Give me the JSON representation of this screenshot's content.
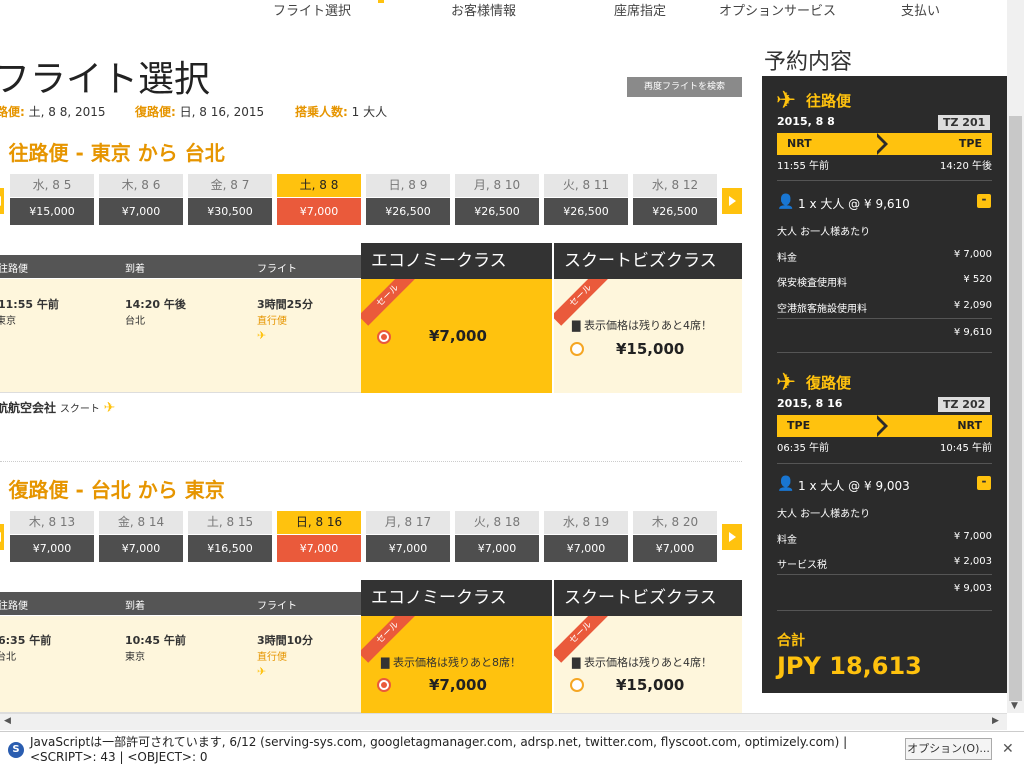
{
  "steps": [
    "フライト選択",
    "お客様情報",
    "座席指定",
    "オプションサービス",
    "支払い"
  ],
  "page_title": "フライト選択",
  "summary": {
    "out_label": "路便:",
    "out_value": "土, 8 8, 2015",
    "ret_label": "復路便:",
    "ret_value": "日, 8 16, 2015",
    "pax_label": "搭乗人数:",
    "pax_value": "1 大人"
  },
  "research_button": "再度フライトを検索",
  "outbound": {
    "heading": "往路便 - 東京 から 台北",
    "dates": [
      {
        "day": "水, 8 5",
        "price": "¥15,000"
      },
      {
        "day": "木, 8 6",
        "price": "¥7,000"
      },
      {
        "day": "金, 8 7",
        "price": "¥30,500"
      },
      {
        "day": "土, 8 8",
        "price": "¥7,000",
        "selected": true
      },
      {
        "day": "日, 8 9",
        "price": "¥26,500"
      },
      {
        "day": "月, 8 10",
        "price": "¥26,500"
      },
      {
        "day": "火, 8 11",
        "price": "¥26,500"
      },
      {
        "day": "水, 8 12",
        "price": "¥26,500"
      }
    ],
    "col_dep": "往路便",
    "col_arr": "到着",
    "col_flight": "フライト",
    "economy": "エコノミークラス",
    "business": "スクートビズクラス",
    "dep_time": "11:55 午前",
    "dep_city": "東京",
    "arr_time": "14:20 午後",
    "arr_city": "台北",
    "duration": "3時間25分",
    "stops": "直行便",
    "sale": "セール",
    "econ_price": "¥7,000",
    "biz_remaining": "表示価格は残りあと4席！",
    "biz_price": "¥15,000",
    "airline_label": "航航空会社",
    "airline_name": "スクート"
  },
  "inbound": {
    "heading": "復路便 - 台北 から 東京",
    "dates": [
      {
        "day": "木, 8 13",
        "price": "¥7,000"
      },
      {
        "day": "金, 8 14",
        "price": "¥7,000"
      },
      {
        "day": "土, 8 15",
        "price": "¥16,500"
      },
      {
        "day": "日, 8 16",
        "price": "¥7,000",
        "selected": true
      },
      {
        "day": "月, 8 17",
        "price": "¥7,000"
      },
      {
        "day": "火, 8 18",
        "price": "¥7,000"
      },
      {
        "day": "水, 8 19",
        "price": "¥7,000"
      },
      {
        "day": "木, 8 20",
        "price": "¥7,000"
      }
    ],
    "col_dep": "往路便",
    "col_arr": "到着",
    "col_flight": "フライト",
    "economy": "エコノミークラス",
    "business": "スクートビズクラス",
    "dep_time": "6:35 午前",
    "dep_city": "台北",
    "arr_time": "10:45 午前",
    "arr_city": "東京",
    "duration": "3時間10分",
    "stops": "直行便",
    "sale": "セール",
    "econ_remaining": "表示価格は残りあと8席！",
    "econ_price": "¥7,000",
    "biz_remaining": "表示価格は残りあと4席！",
    "biz_price": "¥15,000"
  },
  "sidebar": {
    "title": "予約内容",
    "out": {
      "label": "往路便",
      "date": "2015, 8 8",
      "flight": "TZ 201",
      "from": "NRT",
      "to": "TPE",
      "dep": "11:55 午前",
      "arr": "14:20 午後",
      "pax": "1 x 大人 @ ¥ 9,610",
      "per": "大人 お一人様あたり",
      "fare_label": "料金",
      "fare": "¥ 7,000",
      "fee1_label": "保安検査使用料",
      "fee1": "¥ 520",
      "fee2_label": "空港旅客施設使用料",
      "fee2": "¥ 2,090",
      "subtotal": "¥ 9,610"
    },
    "ret": {
      "label": "復路便",
      "date": "2015, 8 16",
      "flight": "TZ 202",
      "from": "TPE",
      "to": "NRT",
      "dep": "06:35 午前",
      "arr": "10:45 午前",
      "pax": "1 x 大人 @ ¥ 9,003",
      "per": "大人 お一人様あたり",
      "fare_label": "料金",
      "fare": "¥ 7,000",
      "fee1_label": "サービス税",
      "fee1": "¥ 2,003",
      "subtotal": "¥ 9,003"
    },
    "total_label": "合計",
    "total": "JPY 18,613"
  },
  "notification": {
    "text": "JavaScriptは一部許可されています, 6/12 (serving-sys.com, googletagmanager.com, adrsp.net, twitter.com, flyscoot.com, optimizely.com) | <SCRIPT>: 43 | <OBJECT>: 0",
    "options_button": "オプション(O)..."
  },
  "colors": {
    "accent": "#ffc20e",
    "sale": "#ea5a3b",
    "dark": "#2b2b2b"
  }
}
